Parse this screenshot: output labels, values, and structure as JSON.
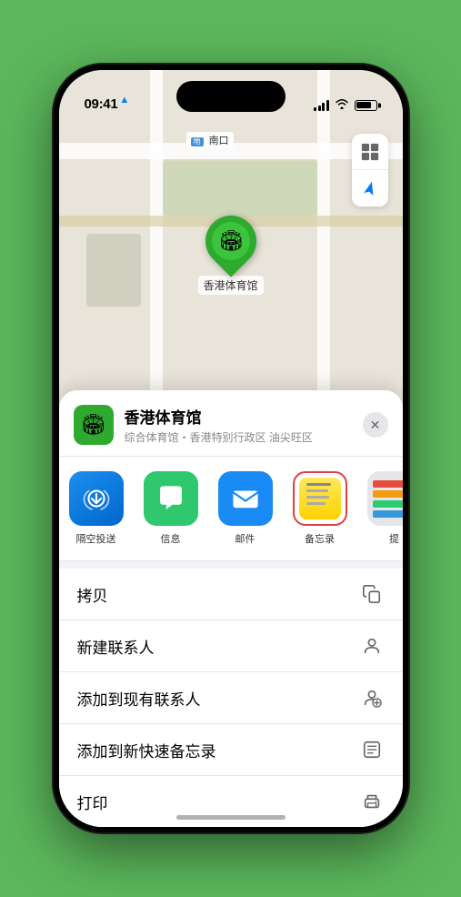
{
  "statusBar": {
    "time": "09:41",
    "locationArrow": "▲"
  },
  "map": {
    "label": "南口",
    "pinLabel": "香港体育馆",
    "controls": {
      "mapIcon": "🗺",
      "locationIcon": "➤"
    }
  },
  "sheet": {
    "venueName": "香港体育馆",
    "venueDesc": "综合体育馆・香港特别行政区 油尖旺区",
    "closeLabel": "✕"
  },
  "shareItems": [
    {
      "id": "airdrop",
      "label": "隔空投送",
      "type": "airdrop"
    },
    {
      "id": "message",
      "label": "信息",
      "type": "message"
    },
    {
      "id": "mail",
      "label": "邮件",
      "type": "mail"
    },
    {
      "id": "notes",
      "label": "备忘录",
      "type": "notes"
    },
    {
      "id": "more",
      "label": "提",
      "type": "more"
    }
  ],
  "actionItems": [
    {
      "id": "copy",
      "label": "拷贝",
      "icon": "📋"
    },
    {
      "id": "new-contact",
      "label": "新建联系人",
      "icon": "👤"
    },
    {
      "id": "add-existing",
      "label": "添加到现有联系人",
      "icon": "👤"
    },
    {
      "id": "add-notes",
      "label": "添加到新快速备忘录",
      "icon": "📝"
    },
    {
      "id": "print",
      "label": "打印",
      "icon": "🖨"
    }
  ],
  "colors": {
    "green": "#2eaa2e",
    "blue": "#1a8af5",
    "red": "#e53e3e",
    "notesYellow": "#ffd700"
  }
}
